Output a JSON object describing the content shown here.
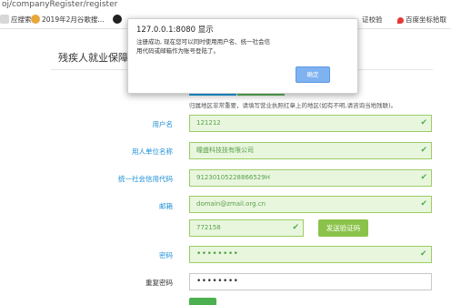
{
  "browser": {
    "url": "oj/companyRegister/register",
    "bookmarks": [
      {
        "label": "应搜索",
        "icon": "doc-icon"
      },
      {
        "label": "2019年2月谷歌搜...",
        "icon": "search-engine-icon"
      },
      {
        "label": "",
        "icon": "globe-icon"
      },
      {
        "label": "证校验",
        "icon": ""
      },
      {
        "label": "百度坐标拾取",
        "icon": "map-pin-icon"
      }
    ]
  },
  "page": {
    "title": "残疾人就业保障",
    "note": "归属地区非常重要，请填写营业执照红章上的地区(如有不明,请咨询当地残联)。"
  },
  "form": {
    "username": {
      "label": "用户名",
      "value": "121212"
    },
    "company": {
      "label": "用人单位名称",
      "value": "瞳盛科技技有限公司"
    },
    "credit_code": {
      "label": "统一社会信用代码",
      "value": "91230105228866529H"
    },
    "email": {
      "label": "邮箱",
      "value": "domain@zmail.org.cn"
    },
    "verify_code": {
      "value": "772158"
    },
    "send_code_label": "发送验证码",
    "password": {
      "label": "密码",
      "value": "••••••••"
    },
    "confirm_password": {
      "label": "重复密码",
      "value": "••••••••"
    }
  },
  "alert": {
    "title": "127.0.0.1:8080 显示",
    "message": "注册成功, 现在您可以同时使用用户名、统一社会信用代码或邮箱作为账号登陆了。",
    "ok_label": "确定"
  },
  "colors": {
    "field_valid_border": "#9ccc65",
    "field_valid_bg": "#e9f6de",
    "label_blue": "#1e90d6",
    "button_green": "#8bc34a",
    "alert_button": "#7fb2f0"
  }
}
